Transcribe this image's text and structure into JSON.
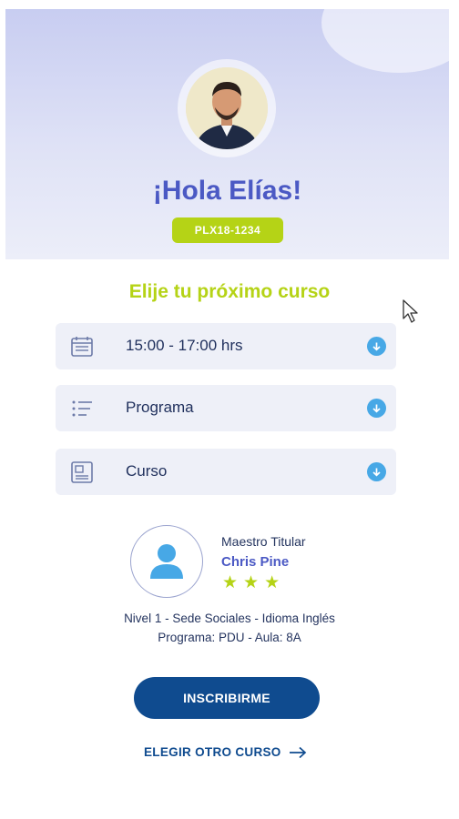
{
  "header": {
    "greeting": "¡Hola Elías!",
    "code": "PLX18-1234"
  },
  "course_picker": {
    "title": "Elije tu próximo curso",
    "fields": [
      {
        "icon": "calendar-icon",
        "value": "15:00 - 17:00 hrs"
      },
      {
        "icon": "list-icon",
        "value": "Programa"
      },
      {
        "icon": "layout-icon",
        "value": "Curso"
      }
    ]
  },
  "teacher": {
    "role": "Maestro Titular",
    "name": "Chris Pine",
    "rating": 3
  },
  "course_info": {
    "line1": "Nivel 1  -  Sede Sociales  -  Idioma Inglés",
    "line2": "Programa: PDU  -  Aula: 8A"
  },
  "actions": {
    "primary": "INSCRIBIRME",
    "secondary": "ELEGIR OTRO CURSO"
  },
  "colors": {
    "brand_blue": "#0f4b8f",
    "accent_purple": "#4b59c4",
    "accent_lime": "#b5d316",
    "dropdown_blue": "#47a8e6"
  }
}
